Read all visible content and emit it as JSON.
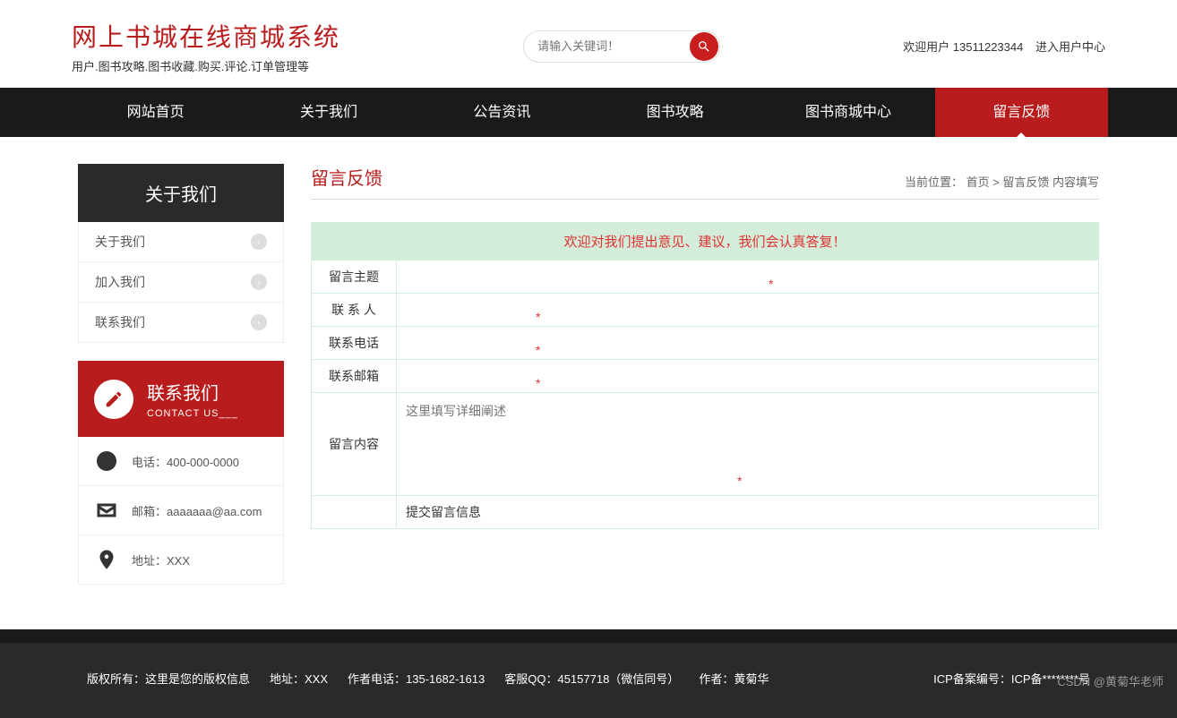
{
  "header": {
    "title": "网上书城在线商城系统",
    "subtitle": "用户.图书攻略.图书收藏.购买.评论.订单管理等",
    "search_placeholder": "请输入关键词！",
    "welcome_prefix": "欢迎用户 ",
    "username": "13511223344",
    "user_center": "进入用户中心"
  },
  "nav": {
    "items": [
      "网站首页",
      "关于我们",
      "公告资讯",
      "图书攻略",
      "图书商城中心",
      "留言反馈"
    ],
    "active_index": 5
  },
  "sidebar": {
    "title": "关于我们",
    "items": [
      "关于我们",
      "加入我们",
      "联系我们"
    ],
    "contact": {
      "title": "联系我们",
      "subtitle": "CONTACT US___",
      "phone": "电话：400-000-0000",
      "email": "邮箱：aaaaaaa@aa.com",
      "address": "地址：XXX"
    }
  },
  "main": {
    "title": "留言反馈",
    "breadcrumb": "当前位置： 首页 > 留言反馈 内容填写",
    "form": {
      "banner": "欢迎对我们提出意见、建议，我们会认真答复！",
      "fields": {
        "subject": "留言主题",
        "contact_person": "联 系 人",
        "phone": "联系电话",
        "email": "联系邮箱",
        "content": "留言内容",
        "content_placeholder": "这里填写详细阐述"
      },
      "required_mark": "*",
      "submit": "提交留言信息"
    }
  },
  "footer": {
    "copyright": "版权所有：这里是您的版权信息",
    "address": "地址：XXX",
    "author_phone": "作者电话：135-1682-1613",
    "qq": "客服QQ：45157718（微信同号）",
    "author": "作者：黄菊华",
    "icp": "ICP备案编号：ICP备********号"
  },
  "watermark": "CSDN @黄菊华老师"
}
